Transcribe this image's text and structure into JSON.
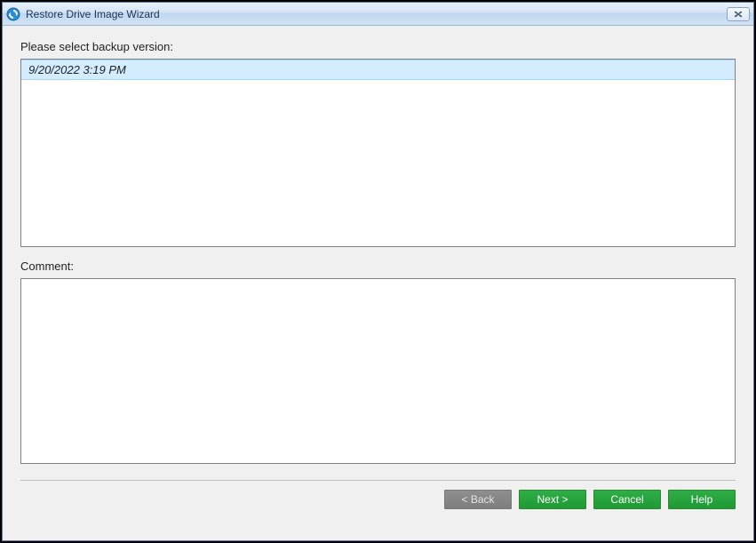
{
  "window": {
    "title": "Restore Drive Image Wizard"
  },
  "main": {
    "select_label": "Please select backup version:",
    "versions": [
      {
        "timestamp": "9/20/2022 3:19 PM",
        "selected": true
      }
    ],
    "comment_label": "Comment:",
    "comment_value": ""
  },
  "buttons": {
    "back": "< Back",
    "next": "Next >",
    "cancel": "Cancel",
    "help": "Help"
  }
}
